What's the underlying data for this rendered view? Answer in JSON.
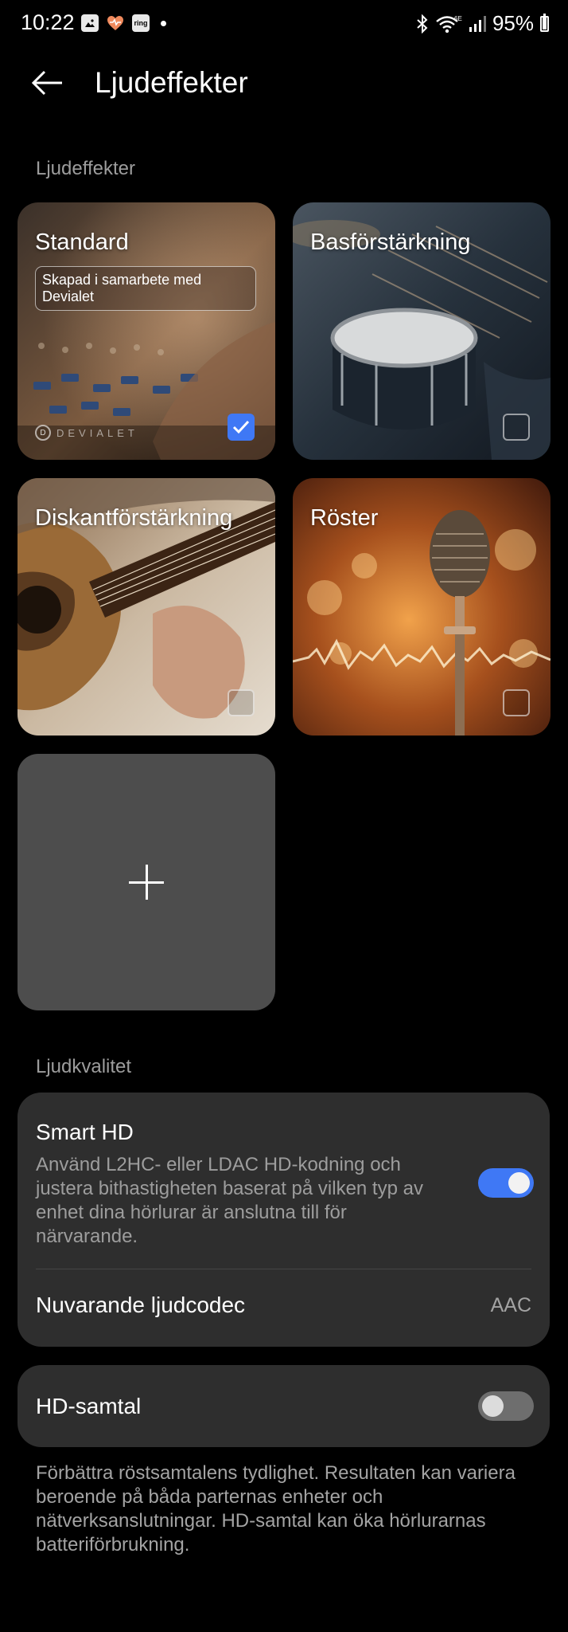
{
  "status_bar": {
    "time": "10:22",
    "battery": "95%",
    "notification_icons": [
      "gallery-icon",
      "heart-icon",
      "ring-app-icon"
    ],
    "ring_label": "ring",
    "right_icons": [
      "bluetooth-icon",
      "wifi-6e-icon",
      "signal-icon",
      "battery-icon"
    ]
  },
  "header": {
    "title": "Ljudeffekter",
    "back_icon": "arrow-left-icon"
  },
  "effects_section": {
    "label": "Ljudeffekter",
    "cards": [
      {
        "title": "Standard",
        "badge": "Skapad i samarbete med Devialet",
        "logo_text": "DEVIALET",
        "checked": true
      },
      {
        "title": "Basförstärkning",
        "checked": false
      },
      {
        "title": "Diskantförstärkning",
        "checked": false
      },
      {
        "title": "Röster",
        "checked": false
      }
    ],
    "add_icon": "plus-icon"
  },
  "quality_section": {
    "label": "Ljudkvalitet",
    "smart_hd": {
      "title": "Smart HD",
      "description": "Använd L2HC- eller LDAC HD-kodning och justera bithastigheten baserat på vilken typ av enhet dina hörlurar är anslutna till för närvarande.",
      "enabled": true
    },
    "codec": {
      "title": "Nuvarande ljudcodec",
      "value": "AAC"
    }
  },
  "hd_call": {
    "title": "HD-samtal",
    "enabled": false,
    "description": "Förbättra röstsamtalens tydlighet. Resultaten kan variera beroende på båda parternas enheter och nätverksanslutningar. HD-samtal kan öka hörlurarnas batteriförbrukning."
  },
  "colors": {
    "accent": "#3f78f5",
    "panel": "#2e2e2e",
    "secondary_text": "#9d9d9d"
  }
}
